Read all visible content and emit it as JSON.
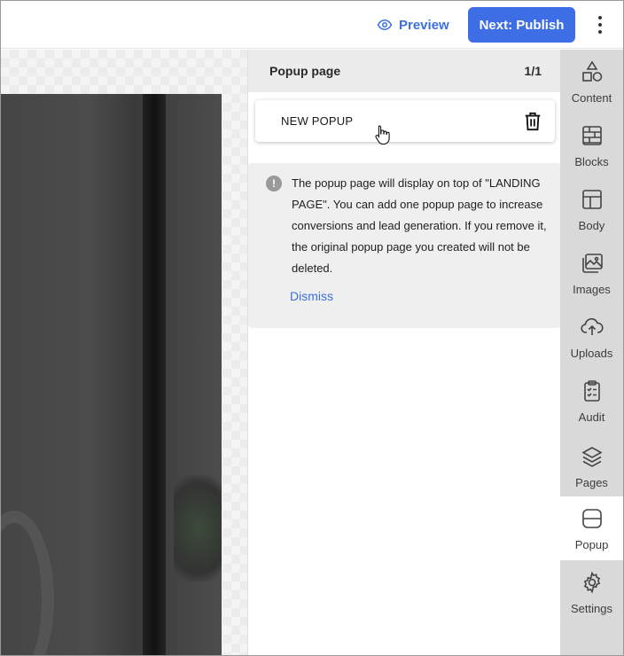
{
  "topbar": {
    "preview_label": "Preview",
    "publish_label": "Next: Publish",
    "accent": "#3d6ee6"
  },
  "panel": {
    "title": "Popup page",
    "count": "1/1",
    "popup_name": "NEW POPUP",
    "notice_text": "The popup page will display on top of \"LANDING PAGE\". You can add one popup page to increase conversions and lead generation. If you remove it, the original popup page you created will not be deleted.",
    "dismiss_label": "Dismiss"
  },
  "sidebar": {
    "items": [
      {
        "label": "Content",
        "icon": "shapes-icon"
      },
      {
        "label": "Blocks",
        "icon": "blocks-icon"
      },
      {
        "label": "Body",
        "icon": "layout-icon"
      },
      {
        "label": "Images",
        "icon": "images-icon"
      },
      {
        "label": "Uploads",
        "icon": "cloud-upload-icon"
      },
      {
        "label": "Audit",
        "icon": "clipboard-check-icon"
      },
      {
        "label": "Pages",
        "icon": "layers-icon"
      },
      {
        "label": "Popup",
        "icon": "popup-icon",
        "active": true
      },
      {
        "label": "Settings",
        "icon": "gear-icon"
      }
    ]
  }
}
